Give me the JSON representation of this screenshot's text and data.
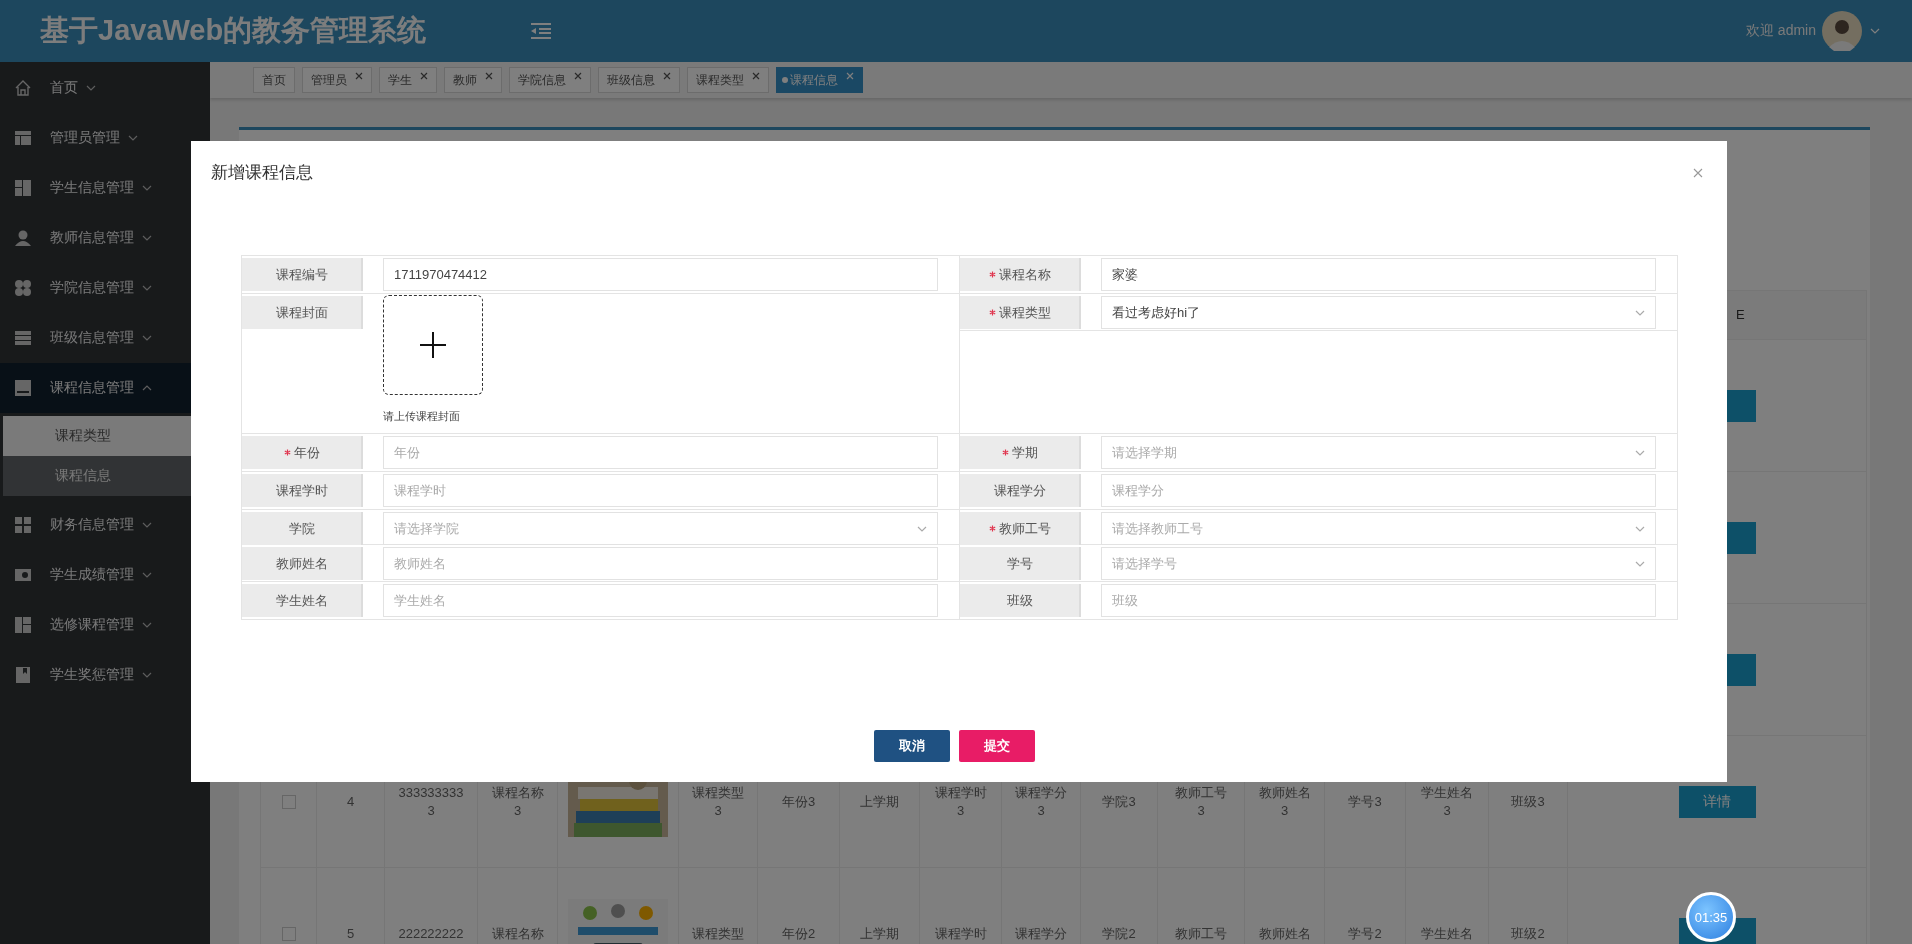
{
  "header": {
    "title": "基于JavaWeb的教务管理系统",
    "welcome": "欢迎 admin"
  },
  "sidebar": {
    "items": [
      {
        "label": "首页",
        "expanded": false
      },
      {
        "label": "管理员管理",
        "expanded": false
      },
      {
        "label": "学生信息管理",
        "expanded": false
      },
      {
        "label": "教师信息管理",
        "expanded": false
      },
      {
        "label": "学院信息管理",
        "expanded": false
      },
      {
        "label": "班级信息管理",
        "expanded": false
      },
      {
        "label": "课程信息管理",
        "expanded": true,
        "children": [
          {
            "label": "课程类型",
            "selected": false,
            "hovered": true
          },
          {
            "label": "课程信息",
            "selected": true,
            "hovered": false
          }
        ]
      },
      {
        "label": "财务信息管理",
        "expanded": false
      },
      {
        "label": "学生成绩管理",
        "expanded": false
      },
      {
        "label": "选修课程管理",
        "expanded": false
      },
      {
        "label": "学生奖惩管理",
        "expanded": false
      }
    ]
  },
  "tabs": [
    {
      "label": "首页",
      "closable": false,
      "selected": false
    },
    {
      "label": "管理员",
      "closable": true,
      "selected": false
    },
    {
      "label": "学生",
      "closable": true,
      "selected": false
    },
    {
      "label": "教师",
      "closable": true,
      "selected": false
    },
    {
      "label": "学院信息",
      "closable": true,
      "selected": false
    },
    {
      "label": "班级信息",
      "closable": true,
      "selected": false
    },
    {
      "label": "课程类型",
      "closable": true,
      "selected": false
    },
    {
      "label": "课程信息",
      "closable": true,
      "selected": true
    }
  ],
  "table": {
    "header_fragment": "E",
    "rows": [
      {
        "checked": false,
        "cells": [
          "4",
          "3333333333",
          "课程名称3",
          "课程类型3",
          "年份3",
          "上学期",
          "课程学时3",
          "课程学分3",
          "学院3",
          "教师工号3",
          "教师姓名3",
          "学号3",
          "学生姓名3",
          "班级3"
        ],
        "action": "详情"
      },
      {
        "checked": false,
        "cells": [
          "5",
          "222222222",
          "课程名称",
          "课程类型",
          "年份2",
          "上学期",
          "课程学时",
          "课程学分",
          "学院2",
          "教师工号",
          "教师姓名",
          "学号2",
          "学生姓名",
          "班级2"
        ]
      }
    ]
  },
  "dialog": {
    "title": "新增课程信息",
    "fields": [
      {
        "label": "课程编号",
        "kind": "text",
        "required": false,
        "value": "1711970474412"
      },
      {
        "label": "课程名称",
        "kind": "text",
        "required": true,
        "value": "家婆"
      },
      {
        "label": "课程封面",
        "kind": "upload",
        "required": false,
        "hint": "请上传课程封面"
      },
      {
        "label": "课程类型",
        "kind": "select",
        "required": true,
        "value": "看过考虑好hi了"
      },
      {
        "label": "年份",
        "kind": "text",
        "required": true,
        "placeholder": "年份"
      },
      {
        "label": "学期",
        "kind": "select",
        "required": true,
        "placeholder": "请选择学期"
      },
      {
        "label": "课程学时",
        "kind": "text",
        "required": false,
        "placeholder": "课程学时"
      },
      {
        "label": "课程学分",
        "kind": "text",
        "required": false,
        "placeholder": "课程学分"
      },
      {
        "label": "学院",
        "kind": "select",
        "required": false,
        "placeholder": "请选择学院"
      },
      {
        "label": "教师工号",
        "kind": "select",
        "required": true,
        "placeholder": "请选择教师工号"
      },
      {
        "label": "教师姓名",
        "kind": "text",
        "required": false,
        "placeholder": "教师姓名"
      },
      {
        "label": "学号",
        "kind": "select",
        "required": false,
        "placeholder": "请选择学号"
      },
      {
        "label": "学生姓名",
        "kind": "text",
        "required": false,
        "placeholder": "学生姓名"
      },
      {
        "label": "班级",
        "kind": "text",
        "required": false,
        "placeholder": "班级"
      }
    ],
    "buttons": [
      {
        "label": "取消",
        "kind": "cancel"
      },
      {
        "label": "提交",
        "kind": "submit"
      }
    ]
  },
  "timer": "01:35"
}
